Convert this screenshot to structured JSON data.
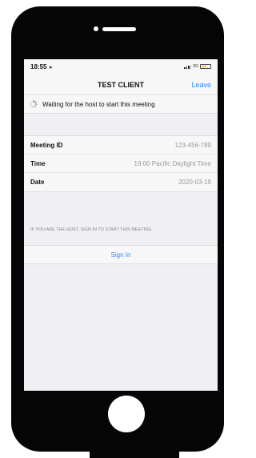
{
  "status_bar": {
    "time": "18:55",
    "network": "5G"
  },
  "nav": {
    "title": "TEST CLIENT",
    "leave_label": "Leave"
  },
  "waiting": {
    "text": "Waiting for the host to start this meeting"
  },
  "meeting_info": [
    {
      "label": "Meeting ID",
      "value": "123-456-789"
    },
    {
      "label": "Time",
      "value": "19:00 Pacific Daylight Time"
    },
    {
      "label": "Date",
      "value": "2020-03-19"
    }
  ],
  "host_hint": "IF YOU ARE THE HOST, SIGN IN TO START THIS MEETING",
  "sign_in_label": "Sign In",
  "colors": {
    "accent": "#2d8cff",
    "phone_body": "#050505",
    "background": "#efeff4"
  }
}
